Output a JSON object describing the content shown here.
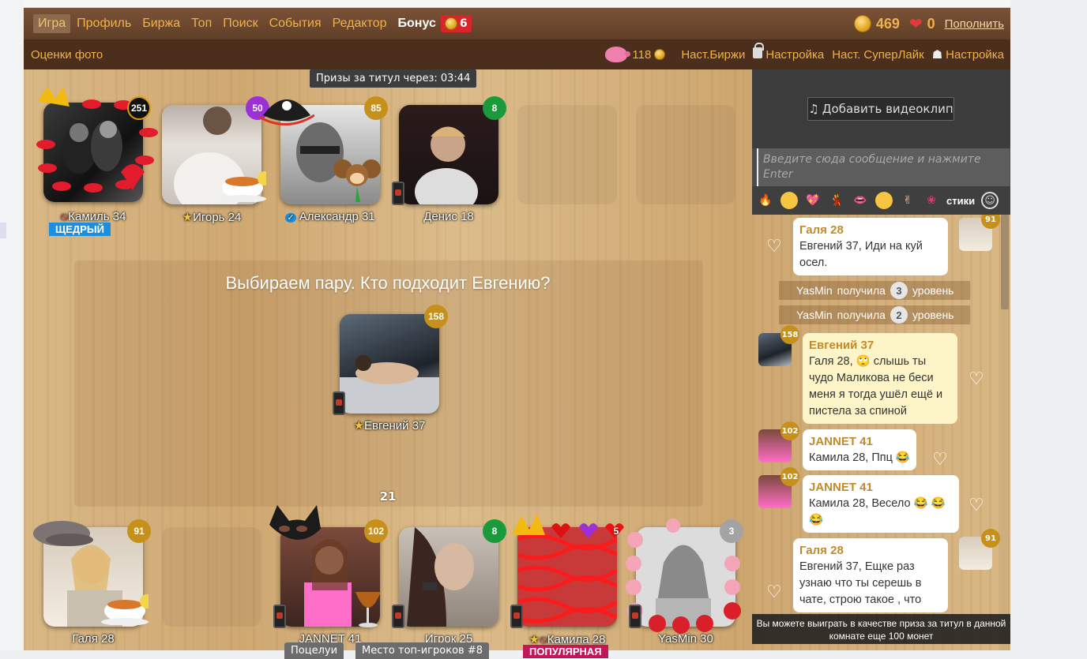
{
  "nav": {
    "items": [
      "Игра",
      "Профиль",
      "Биржа",
      "Топ",
      "Поиск",
      "События",
      "Редактор"
    ],
    "bonus_label": "Бонус",
    "bonus_count": "6",
    "coins": "469",
    "hearts": "0",
    "topup_label": "Пополнить"
  },
  "subbar": {
    "photo_ratings": "Оценки фото",
    "piggy_coins": "118",
    "exchange_settings": "Наст.Биржи",
    "settings_1": "Настройка",
    "superlike_settings": "Наст. СуперЛайк",
    "settings_2": "Настройка"
  },
  "table": {
    "prize_timer": "Призы за титул через: 03:44",
    "center_title": "Выбираем пару. Кто подходит Евгению?",
    "round": "21",
    "top_seats": [
      {
        "name": "Камиль 34",
        "level": "251",
        "tag": "ЩЕДРЫЙ"
      },
      {
        "name": "Игорь 24",
        "level": "50"
      },
      {
        "name": "Александр 31",
        "level": "85"
      },
      {
        "name": "Денис 18",
        "level": "8"
      }
    ],
    "center_player": {
      "name": "Евгений 37",
      "level": "158"
    },
    "bottom_seats": [
      {
        "name": "Галя 28",
        "level": "91"
      },
      {
        "name": "JANNET 41",
        "level": "102"
      },
      {
        "name": "Игрок 25",
        "level": "8"
      },
      {
        "name": "Камила 28",
        "level": "5",
        "tag": "ПОПУЛЯРНАЯ"
      },
      {
        "name": "YasMin 30",
        "level": "3"
      }
    ],
    "bottom_buttons": [
      "Поцелуи",
      "Место топ-игроков #8"
    ]
  },
  "sidebar": {
    "video_button": "Добавить видеоклип",
    "input_placeholder": "Введите сюда сообщение и нажмите Enter",
    "stickers_label": "стики",
    "chat": [
      {
        "author": "Галя 28",
        "text": "Евгений 37, Иди на куй осел.",
        "level": "91"
      },
      {
        "system_name": "YasMin",
        "system_text": "получила",
        "system_level": "3",
        "system_suffix": "уровень"
      },
      {
        "system_name": "YasMin",
        "system_text": "получила",
        "system_level": "2",
        "system_suffix": "уровень"
      },
      {
        "author": "Евгений 37",
        "text": "Галя 28, 🙄 слышь ты чудо Маликова не беси меня я тогда ушёл ещё и пистела за спиной",
        "level": "158"
      },
      {
        "author": "JANNET 41",
        "text": "Камила 28, Ппц 😂",
        "level": "102"
      },
      {
        "author": "JANNET 41",
        "text": "Камила 28, Весело 😂 😂😂",
        "level": "102"
      },
      {
        "author": "Галя 28",
        "text": "Евгений 37, Ещке раз узнаю что ты серешь в чате, строю такое , что",
        "level": "91"
      }
    ],
    "win_note": "Вы можете выиграть в качестве приза за титул в данной комнате еще 100 монет"
  },
  "colors": {
    "nav_bg": "#6b4830",
    "nav_text": "#f0b14a",
    "level_gold": "#c6901a",
    "level_purple": "#9b30d9",
    "level_green": "#1a9a3b",
    "level_black": "#111111",
    "level_gray": "#a3a3a3",
    "tag_blue": "#1a8fe0",
    "tag_pink": "#c2185b"
  }
}
